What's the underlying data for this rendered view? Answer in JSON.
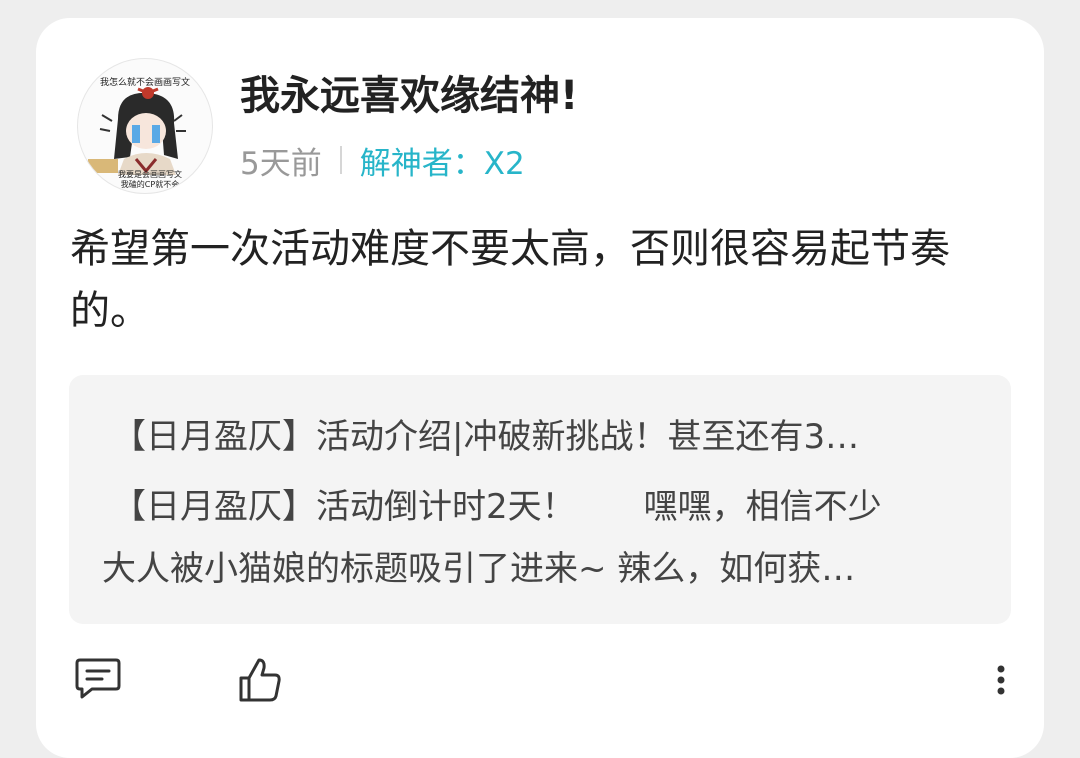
{
  "post": {
    "username": "我永远喜欢缘结神!",
    "time": "5天前",
    "solver": "解神者：X2",
    "content": "希望第一次活动难度不要太高，否则很容易起节奏的。",
    "avatar_text_top": "我怎么就不会画画写文",
    "avatar_text_bottom1": "我要是会画画写文",
    "avatar_text_bottom2": "我磕的CP就不会"
  },
  "quotes": [
    {
      "text": "【日月盈仄】活动介绍|冲破新挑战！甚至还有3…"
    },
    {
      "text": "【日月盈仄】活动倒计时2天！　　嘿嘿，相信不少"
    },
    {
      "text": "大人被小猫娘的标题吸引了进来~ 辣么，如何获…"
    }
  ],
  "actions": {
    "comment_icon": "comment-icon",
    "like_icon": "thumbs-up-icon",
    "more_icon": "more-vertical-icon"
  },
  "colors": {
    "accent": "#27b5c9",
    "time": "#999999",
    "quote_bg": "#f4f4f4"
  }
}
